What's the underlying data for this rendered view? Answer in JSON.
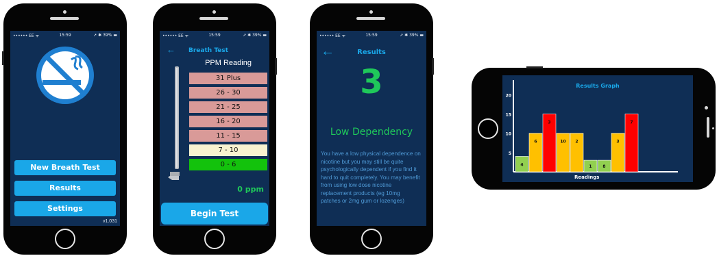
{
  "colors": {
    "screen_bg": "#0f2e55",
    "accent_blue": "#1aa7e8",
    "green": "#1fc85a",
    "range_high": "#d99a98",
    "range_mid": "#f8f3d0",
    "range_low": "#13c20c",
    "bar_green": "#92d050",
    "bar_orange": "#ffc000",
    "bar_red": "#ff0000"
  },
  "status_bar": {
    "carrier": "•••••• EE ᯤ",
    "time": "15:59",
    "battery": "➚ ✱ 39% ▬"
  },
  "home_screen": {
    "logo_icon": "no-smoking-icon",
    "buttons": [
      "New Breath Test",
      "Results",
      "Settings"
    ],
    "version": "v1.031"
  },
  "breath_test_screen": {
    "back_icon": "arrow-left-icon",
    "title": "Breath Test",
    "subtitle": "PPM Reading",
    "ranges": [
      "31 Plus",
      "26 - 30",
      "21 - 25",
      "16 - 20",
      "11 - 15",
      "7 - 10",
      "0 - 6"
    ],
    "reading": "0 ppm",
    "begin_button": "Begin Test"
  },
  "results_screen": {
    "back_icon": "arrow-left-icon",
    "title": "Results",
    "score": "3",
    "dependency": "Low Dependency",
    "description": "You have a low physical dependence on nicotine but you may still be quite psychologically dependent if you find it hard to quit completely. You may benefit from using low dose nicotine replacement products (eg 10mg patches or 2mg gum or lozenges)"
  },
  "graph_screen": {
    "title": "Results Graph",
    "xlabel": "Readings",
    "ticks": [
      "5",
      "10",
      "15",
      "20"
    ]
  },
  "chart_data": {
    "type": "bar",
    "title": "Results Graph",
    "xlabel": "Readings",
    "ylabel": "",
    "ylim": [
      0,
      22
    ],
    "yticks": [
      5,
      10,
      15,
      20
    ],
    "values": [
      4,
      6,
      3,
      10,
      2,
      1,
      8,
      3,
      7
    ],
    "heights": [
      4,
      10,
      15,
      10,
      10,
      3,
      3,
      10,
      15
    ],
    "colors": [
      "#92d050",
      "#ffc000",
      "#ff0000",
      "#ffc000",
      "#ffc000",
      "#92d050",
      "#92d050",
      "#ffc000",
      "#ff0000"
    ]
  }
}
